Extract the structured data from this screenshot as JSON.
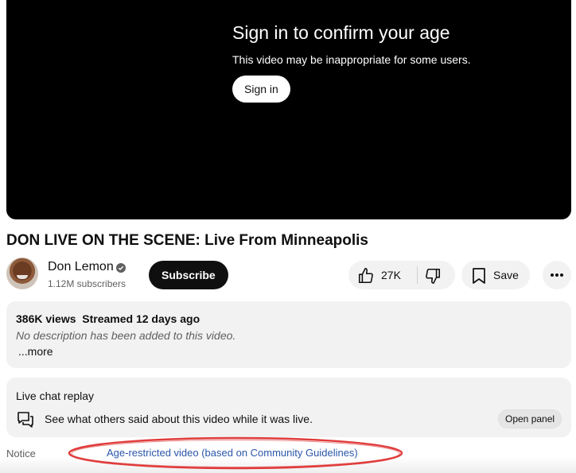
{
  "player": {
    "gate_title": "Sign in to confirm your age",
    "gate_subtitle": "This video may be inappropriate for some users.",
    "signin_label": "Sign in"
  },
  "video": {
    "title": "DON LIVE ON THE SCENE: Live From Minneapolis"
  },
  "channel": {
    "name": "Don Lemon",
    "subscribers": "1.12M subscribers",
    "subscribe_label": "Subscribe",
    "verified_icon": "verified-check-icon"
  },
  "actions": {
    "like_count": "27K",
    "like_icon": "thumbs-up-icon",
    "dislike_icon": "thumbs-down-icon",
    "save_label": "Save",
    "save_icon": "bookmark-icon",
    "more_icon": "more-horizontal-icon"
  },
  "description": {
    "meta": "386K views  Streamed 12 days ago",
    "text": "No description has been added to this video.",
    "more_label": "...more"
  },
  "chat": {
    "title": "Live chat replay",
    "description": "See what others said about this video while it was live.",
    "open_panel_label": "Open panel",
    "icon": "chat-bubbles-icon"
  },
  "notice": {
    "label": "Notice",
    "link_text": "Age-restricted video (based on Community Guidelines)",
    "annotation_color": "#e03c3c"
  }
}
